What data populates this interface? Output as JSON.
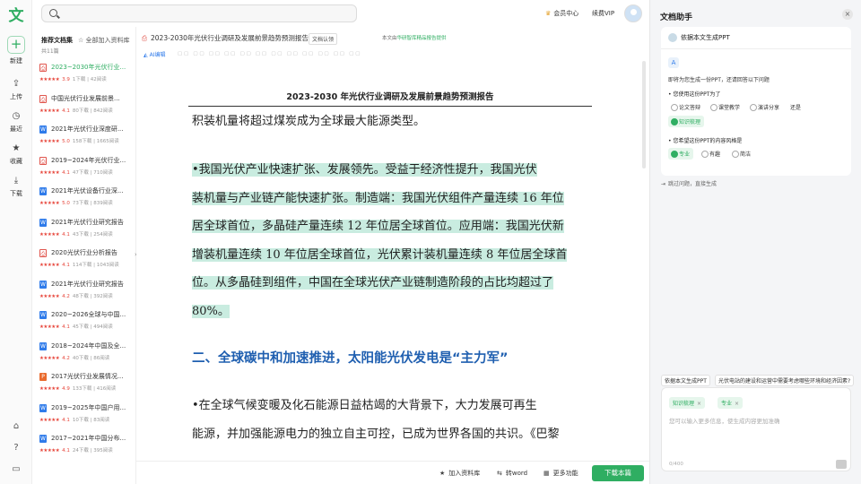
{
  "rail": {
    "logo": "文",
    "new_label": "新建",
    "upload_label": "上传",
    "recent_label": "最近",
    "collect_label": "收藏",
    "download_label": "下载"
  },
  "topbar": {
    "search_placeholder": "",
    "member_center": "会员中心",
    "renew_vip": "续费VIP"
  },
  "leftpanel": {
    "heading": "推荐文档集",
    "add_all": "全部加入资料库",
    "count": "共11篇",
    "docs": [
      {
        "icon": "pdf",
        "title": "2023~2030年光伏行业...",
        "score": "3.9",
        "downloads": "1下载",
        "reads": "42阅读",
        "active": true
      },
      {
        "icon": "pdf",
        "title": "中国光伏行业发展前景...",
        "score": "4.1",
        "downloads": "80下载",
        "reads": "842阅读",
        "active": false
      },
      {
        "icon": "word",
        "title": "2021年光伏行业深度研...",
        "score": "5.0",
        "downloads": "158下载",
        "reads": "1665阅读",
        "active": false
      },
      {
        "icon": "pdf",
        "title": "2019~2024年光伏行业...",
        "score": "4.1",
        "downloads": "47下载",
        "reads": "710阅读",
        "active": false
      },
      {
        "icon": "word",
        "title": "2021年光伏设备行业深...",
        "score": "5.0",
        "downloads": "73下载",
        "reads": "839阅读",
        "active": false
      },
      {
        "icon": "word",
        "title": "2021年光伏行业研究报告",
        "score": "4.1",
        "downloads": "43下载",
        "reads": "254阅读",
        "active": false
      },
      {
        "icon": "pdf",
        "title": "2020光伏行业分析报告",
        "score": "4.1",
        "downloads": "114下载",
        "reads": "1043阅读",
        "active": false
      },
      {
        "icon": "word",
        "title": "2021年光伏行业研究报告",
        "score": "4.2",
        "downloads": "48下载",
        "reads": "392阅读",
        "active": false
      },
      {
        "icon": "word",
        "title": "2020~2026全球与中国...",
        "score": "4.1",
        "downloads": "45下载",
        "reads": "494阅读",
        "active": false
      },
      {
        "icon": "word",
        "title": "2018~2024年中国及全...",
        "score": "4.2",
        "downloads": "40下载",
        "reads": "86阅读",
        "active": false
      },
      {
        "icon": "ppt",
        "title": "2017光伏行业发展情况...",
        "score": "4.9",
        "downloads": "133下载",
        "reads": "416阅读",
        "active": false
      },
      {
        "icon": "word",
        "title": "2019~2025年中国户用...",
        "score": "4.1",
        "downloads": "10下载",
        "reads": "83阅读",
        "active": false
      },
      {
        "icon": "word",
        "title": "2017~2021年中国分布...",
        "score": "4.1",
        "downloads": "24下载",
        "reads": "395阅读",
        "active": false
      }
    ]
  },
  "viewer": {
    "doc_title": "2023-2030年光伏行业调研及发展前景趋势预测报告",
    "tag_recognized": "文档认领",
    "source_prefix": "本文由",
    "source_name": "华研智库精品报告提供",
    "ai_edit": "AI编辑",
    "page_title": "2023-2030 年光伏行业调研及发展前景趋势预测报告",
    "para_top": "积装机量将超过煤炭成为全球最大能源类型。",
    "hl_lines": [
      "•我国光伏产业快速扩张、发展领先。受益于经济性提升，我国光伏",
      "装机量与产业链产能快速扩张。制造端：我国光伏组件产量连续 16 年位",
      "居全球首位，多晶硅产量连续 12 年位居全球首位。应用端：我国光伏新",
      "增装机量连续 10 年位居全球首位，光伏累计装机量连续 8 年位居全球首",
      "位。从多晶硅到组件，中国在全球光伏产业链制造阶段的占比均超过了",
      "80%。"
    ],
    "heading2": "二、全球碳中和加速推进，太阳能光伏发电是“主力军”",
    "para_bottom": [
      "•在全球气候变暖及化石能源日益枯竭的大背景下，大力发展可再生",
      "能源，并加强能源电力的独立自主可控，已成为世界各国的共识。《巴黎"
    ],
    "bottom": {
      "add_library": "加入资料库",
      "to_word": "转word",
      "more": "更多功能",
      "download": "下载本篇"
    }
  },
  "assistant": {
    "title": "文档助手",
    "card_header": "依据本文生成PPT",
    "intro": "即将为您生成一份PPT，还请回答以下问题",
    "q1": "• 您使用这份PPT为了",
    "q1_options": [
      "论文答辩",
      "课堂教学",
      "演讲分享",
      "还是",
      "知识梳理"
    ],
    "q2": "• 您希望这份PPT的内容风格是",
    "q2_options": [
      "专业",
      "有趣",
      "简洁"
    ],
    "skip": "跳过问题，直接生成",
    "chip1": "依据本文生成PPT",
    "chip2": "光伏电站的建设和运营中需要考虑哪些环境和经济因素?",
    "selected1": "知识梳理",
    "selected2": "专业",
    "placeholder": "您可以输入更多信息，使生成内容更加准确",
    "counter": "0/400"
  }
}
